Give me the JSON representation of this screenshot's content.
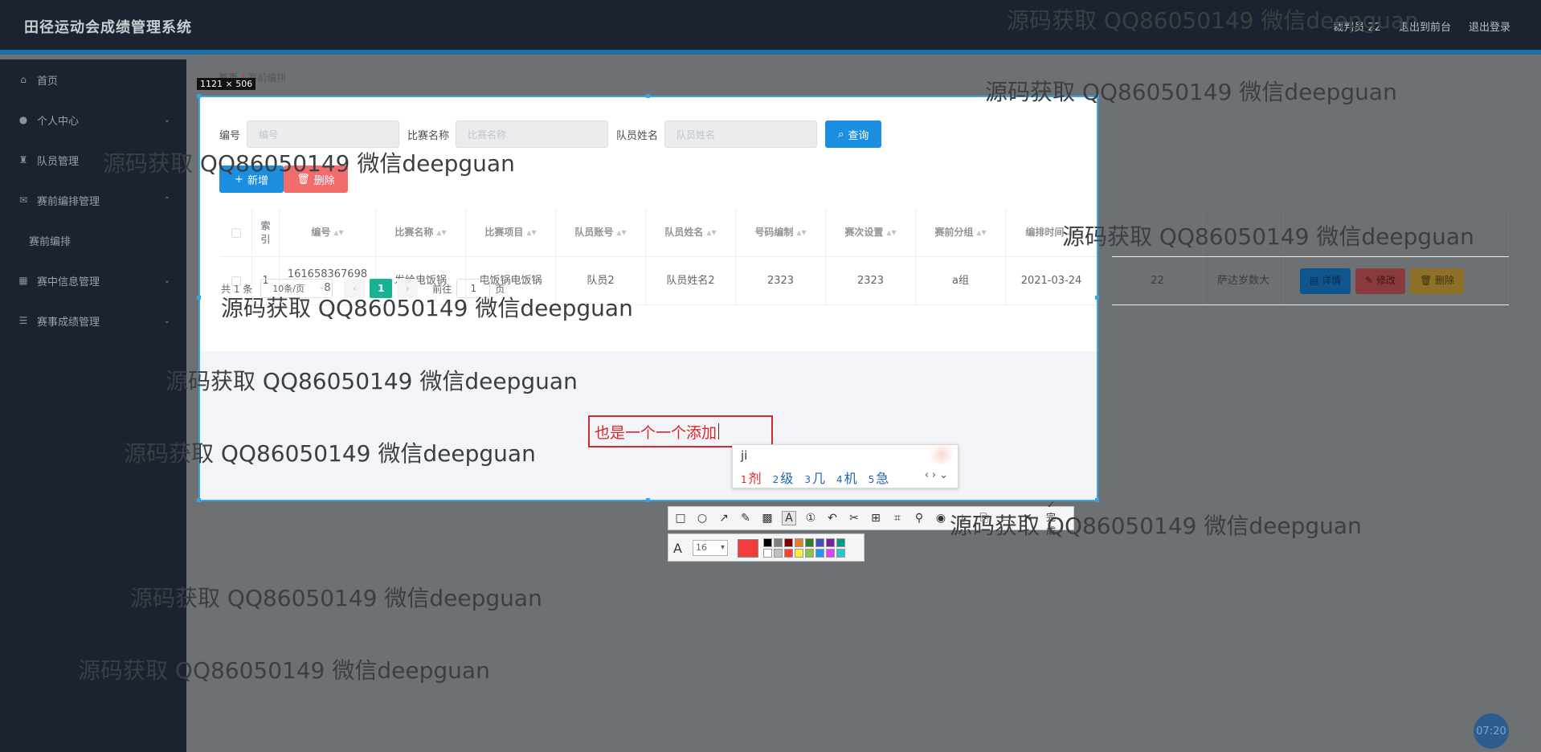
{
  "header": {
    "app_title": "田径运动会成绩管理系统",
    "user": "裁判员 22",
    "back_to_console": "退出到前台",
    "logout": "退出登录"
  },
  "sidebar": {
    "items": [
      {
        "label": "首页",
        "icon": "home-icon"
      },
      {
        "label": "个人中心",
        "icon": "user-icon"
      },
      {
        "label": "队员管理",
        "icon": "trophy-icon"
      },
      {
        "label": "赛前编排管理",
        "icon": "mail-icon"
      },
      {
        "label": "赛前编排",
        "icon": ""
      },
      {
        "label": "赛中信息管理",
        "icon": "grid-icon"
      },
      {
        "label": "赛事成绩管理",
        "icon": "list-icon"
      }
    ]
  },
  "breadcrumb": {
    "home": "首页",
    "current": "赛前编排"
  },
  "capture": {
    "size_label": "1121 × 506"
  },
  "search": {
    "fields": [
      {
        "label": "编号",
        "placeholder": "编号"
      },
      {
        "label": "比赛名称",
        "placeholder": "比赛名称"
      },
      {
        "label": "队员姓名",
        "placeholder": "队员姓名"
      }
    ],
    "query_button": "查询"
  },
  "actions": {
    "add": "新增",
    "delete": "删除"
  },
  "table": {
    "headers": [
      "索引",
      "编号",
      "比赛名称",
      "比赛项目",
      "队员账号",
      "队员姓名",
      "号码编制",
      "赛次设置",
      "赛前分组",
      "编排时间"
    ],
    "row": {
      "index": "1",
      "code": "1616583676988",
      "match_name": "发给电饭锅",
      "event": "电饭锅电饭锅",
      "account": "队员2",
      "name": "队员姓名2",
      "number": "2323",
      "round": "2323",
      "group": "a组",
      "date": "2021-03-24",
      "extra1": "22",
      "extra2": "萨达岁数大"
    },
    "op_buttons": {
      "detail": "详情",
      "edit": "修改",
      "delete": "删除"
    }
  },
  "pagination": {
    "total": "共 1 条",
    "page_size": "10条/页",
    "current": "1",
    "goto_label": "前往",
    "goto_value": "1",
    "page_suffix": "页"
  },
  "annotation": {
    "text": "也是一个一个添加"
  },
  "ime": {
    "pinyin": "ji",
    "candidates": [
      {
        "n": "1",
        "c": "剂"
      },
      {
        "n": "2",
        "c": "级"
      },
      {
        "n": "3",
        "c": "几"
      },
      {
        "n": "4",
        "c": "机"
      },
      {
        "n": "5",
        "c": "急"
      }
    ]
  },
  "screenshot_tool": {
    "done_label": "完成",
    "font_size": "16",
    "current_color": "#f23b3b",
    "palette": [
      "#000000",
      "#808080",
      "#800000",
      "#e08030",
      "#2e7d32",
      "#3f51b5",
      "#7b1fa2",
      "#009688",
      "#ffffff",
      "#c0c0c0",
      "#f44336",
      "#ffeb3b",
      "#8bc34a",
      "#2196f3",
      "#e040fb",
      "#26c6da"
    ]
  },
  "watermark": {
    "text": "源码获取 QQ86050149 微信deepguan"
  },
  "clock": "07:20"
}
